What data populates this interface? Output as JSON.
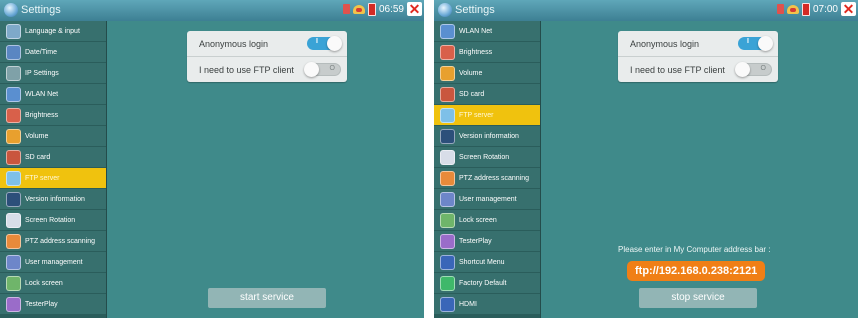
{
  "left": {
    "title": "Settings",
    "time": "06:59",
    "sidebar": [
      {
        "label": "Language & input",
        "icon": "globe-icon",
        "color": "#7ea9c9",
        "active": false
      },
      {
        "label": "Date/Time",
        "icon": "calendar-icon",
        "color": "#5a86c2",
        "active": false
      },
      {
        "label": "IP Settings",
        "icon": "network-icon",
        "color": "#7fa1a8",
        "active": false
      },
      {
        "label": "WLAN Net",
        "icon": "wifi-icon",
        "color": "#5a8fd0",
        "active": false
      },
      {
        "label": "Brightness",
        "icon": "brightness-icon",
        "color": "#d8604a",
        "active": false
      },
      {
        "label": "Volume",
        "icon": "volume-icon",
        "color": "#e8a02e",
        "active": false
      },
      {
        "label": "SD card",
        "icon": "sd-card-icon",
        "color": "#c9563e",
        "active": false
      },
      {
        "label": "FTP server",
        "icon": "ftp-icon",
        "color": "#7ec0e8",
        "active": true
      },
      {
        "label": "Version information",
        "icon": "monitor-icon",
        "color": "#2c4f7a",
        "active": false
      },
      {
        "label": "Screen Rotation",
        "icon": "rotation-icon",
        "color": "#d8dde8",
        "active": false
      },
      {
        "label": "PTZ address scanning",
        "icon": "ptz-icon",
        "color": "#e88a3a",
        "active": false
      },
      {
        "label": "User management",
        "icon": "user-icon",
        "color": "#6d86c9",
        "active": false
      },
      {
        "label": "Lock screen",
        "icon": "lock-icon",
        "color": "#6fb56a",
        "active": false
      },
      {
        "label": "TesterPlay",
        "icon": "play-icon",
        "color": "#9a6cc9",
        "active": false
      }
    ],
    "options": [
      {
        "label": "Anonymous login",
        "state": "on",
        "tag": "I"
      },
      {
        "label": "I need to use FTP client",
        "state": "off",
        "tag": "O"
      }
    ],
    "button": "start service"
  },
  "right": {
    "title": "Settings",
    "time": "07:00",
    "sidebar": [
      {
        "label": "WLAN Net",
        "icon": "wifi-icon",
        "color": "#5a8fd0",
        "active": false
      },
      {
        "label": "Brightness",
        "icon": "brightness-icon",
        "color": "#d8604a",
        "active": false
      },
      {
        "label": "Volume",
        "icon": "volume-icon",
        "color": "#e8a02e",
        "active": false
      },
      {
        "label": "SD card",
        "icon": "sd-card-icon",
        "color": "#c9563e",
        "active": false
      },
      {
        "label": "FTP server",
        "icon": "ftp-icon",
        "color": "#7ec0e8",
        "active": true
      },
      {
        "label": "Version information",
        "icon": "monitor-icon",
        "color": "#2c4f7a",
        "active": false
      },
      {
        "label": "Screen Rotation",
        "icon": "rotation-icon",
        "color": "#d8dde8",
        "active": false
      },
      {
        "label": "PTZ address scanning",
        "icon": "ptz-icon",
        "color": "#e88a3a",
        "active": false
      },
      {
        "label": "User management",
        "icon": "user-icon",
        "color": "#6d86c9",
        "active": false
      },
      {
        "label": "Lock screen",
        "icon": "lock-icon",
        "color": "#6fb56a",
        "active": false
      },
      {
        "label": "TesterPlay",
        "icon": "play-icon",
        "color": "#9a6cc9",
        "active": false
      },
      {
        "label": "Shortcut Menu",
        "icon": "shortcut-icon",
        "color": "#3a66b8",
        "active": false
      },
      {
        "label": "Factory Default",
        "icon": "reset-icon",
        "color": "#3fb86a",
        "active": false
      },
      {
        "label": "HDMI",
        "icon": "hdmi-icon",
        "color": "#3a66b8",
        "active": false
      }
    ],
    "options": [
      {
        "label": "Anonymous login",
        "state": "on",
        "tag": "I"
      },
      {
        "label": "I need to use FTP client",
        "state": "off",
        "tag": "O"
      }
    ],
    "hint": "Please enter in  My Computer address bar :",
    "address": "ftp://192.168.0.238:2121",
    "button": "stop service"
  }
}
